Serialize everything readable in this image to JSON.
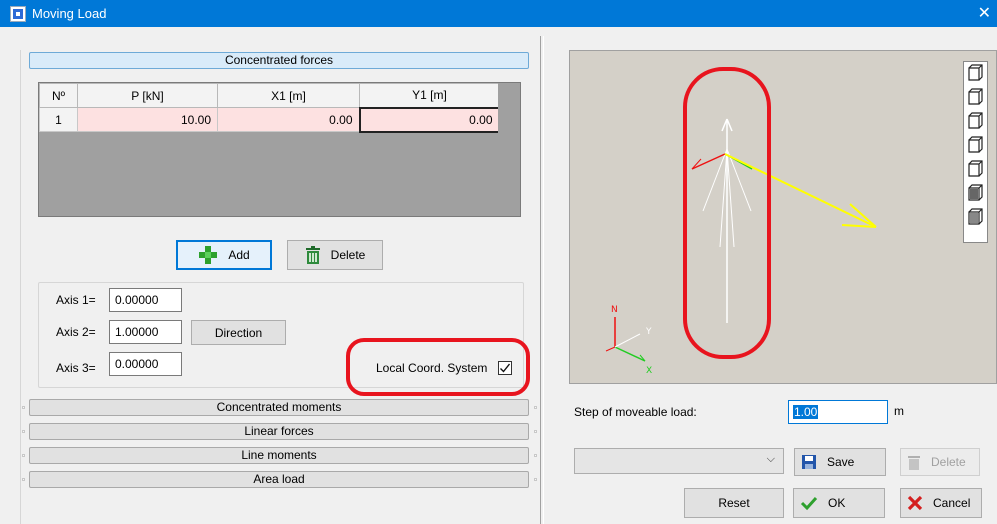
{
  "window": {
    "title": "Moving Load",
    "close_glyph": "✕",
    "icon": "app-grid-icon"
  },
  "sections": {
    "concentrated_forces": "Concentrated forces",
    "concentrated_moments": "Concentrated moments",
    "linear_forces": "Linear forces",
    "line_moments": "Line moments",
    "area_load": "Area load"
  },
  "table": {
    "headers": [
      "Nº",
      "P [kN]",
      "X1 [m]",
      "Y1 [m]"
    ],
    "rows": [
      [
        "1",
        "10.00",
        "0.00",
        "0.00"
      ]
    ]
  },
  "buttons": {
    "add": "Add",
    "delete": "Delete",
    "direction": "Direction",
    "save": "Save",
    "delete_disabled": "Delete",
    "reset": "Reset",
    "ok": "OK",
    "cancel": "Cancel"
  },
  "axes": {
    "axis1_label": "Axis 1=",
    "axis1_value": "0.00000",
    "axis2_label": "Axis 2=",
    "axis2_value": "1.00000",
    "axis3_label": "Axis 3=",
    "axis3_value": "0.00000"
  },
  "local_coord": {
    "label": "Local Coord. System",
    "checked": true
  },
  "step": {
    "label": "Step of moveable load:",
    "value": "1.00",
    "unit": "m"
  },
  "preview": {
    "axis_labels": {
      "x": "X",
      "y": "Y",
      "z": "N"
    }
  },
  "colors": {
    "titlebar": "#0078d7",
    "highlight": "#e8141e",
    "cell_pink": "#fde1e1",
    "load_vector": "#ffff00"
  }
}
